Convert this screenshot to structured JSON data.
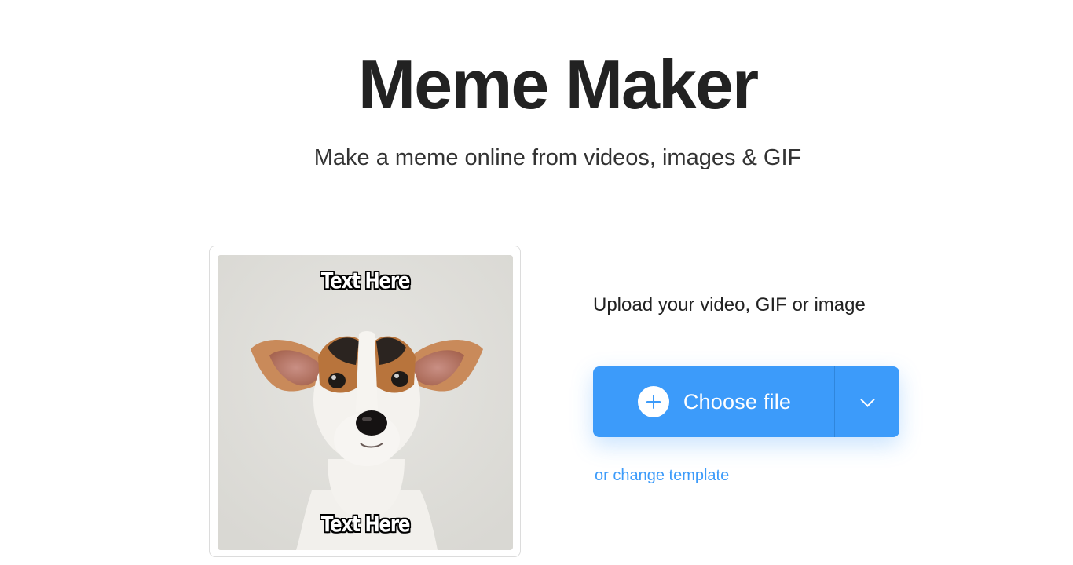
{
  "header": {
    "title": "Meme Maker",
    "subtitle": "Make a meme online from videos, images & GIF"
  },
  "preview": {
    "top_text": "Text Here",
    "bottom_text": "Text Here",
    "image_subject": "puppy-dog"
  },
  "upload": {
    "heading": "Upload your video, GIF or image",
    "choose_file_label": "Choose file",
    "plus_icon": "plus-icon",
    "dropdown_icon": "chevron-down-icon",
    "change_template_label": "or change template"
  },
  "colors": {
    "accent": "#3c9bfa",
    "text": "#222222",
    "image_background": "#e1e0dc"
  }
}
